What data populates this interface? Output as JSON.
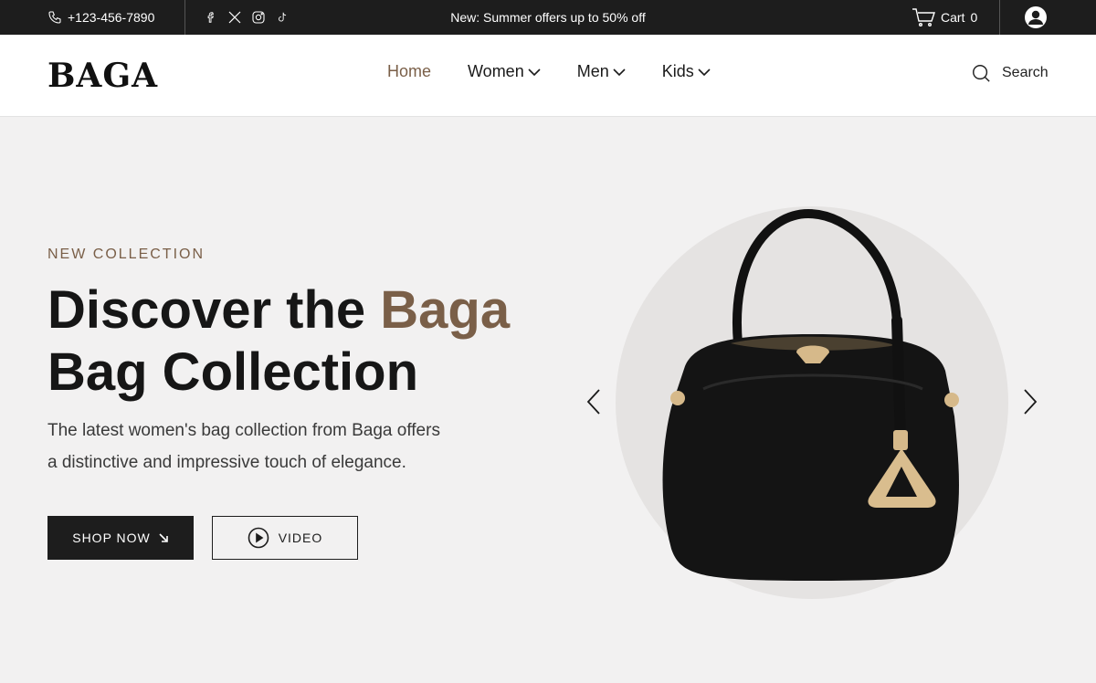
{
  "topbar": {
    "phone": "+123-456-7890",
    "promo": "New: Summer offers up to 50% off",
    "cart_label": "Cart",
    "cart_count": "0",
    "social_icons": [
      "facebook-icon",
      "x-icon",
      "instagram-icon",
      "tiktok-icon"
    ]
  },
  "header": {
    "logo": "BAGA",
    "nav": [
      {
        "label": "Home",
        "active": true
      },
      {
        "label": "Women",
        "has_dropdown": true
      },
      {
        "label": "Men",
        "has_dropdown": true
      },
      {
        "label": "Kids",
        "has_dropdown": true
      }
    ],
    "search_label": "Search"
  },
  "hero": {
    "eyebrow": "NEW COLLECTION",
    "headline_part1": "Discover the ",
    "headline_accent": "Baga",
    "headline_part2": "Bag Collection",
    "description_line1": "The latest women's bag collection from Baga offers",
    "description_line2": "a distinctive and impressive touch of elegance.",
    "shop_button": "SHOP NOW",
    "video_button": "VIDEO"
  },
  "colors": {
    "accent": "#7a5f48",
    "dark": "#1d1d1d",
    "hero_bg": "#f2f1f1"
  }
}
